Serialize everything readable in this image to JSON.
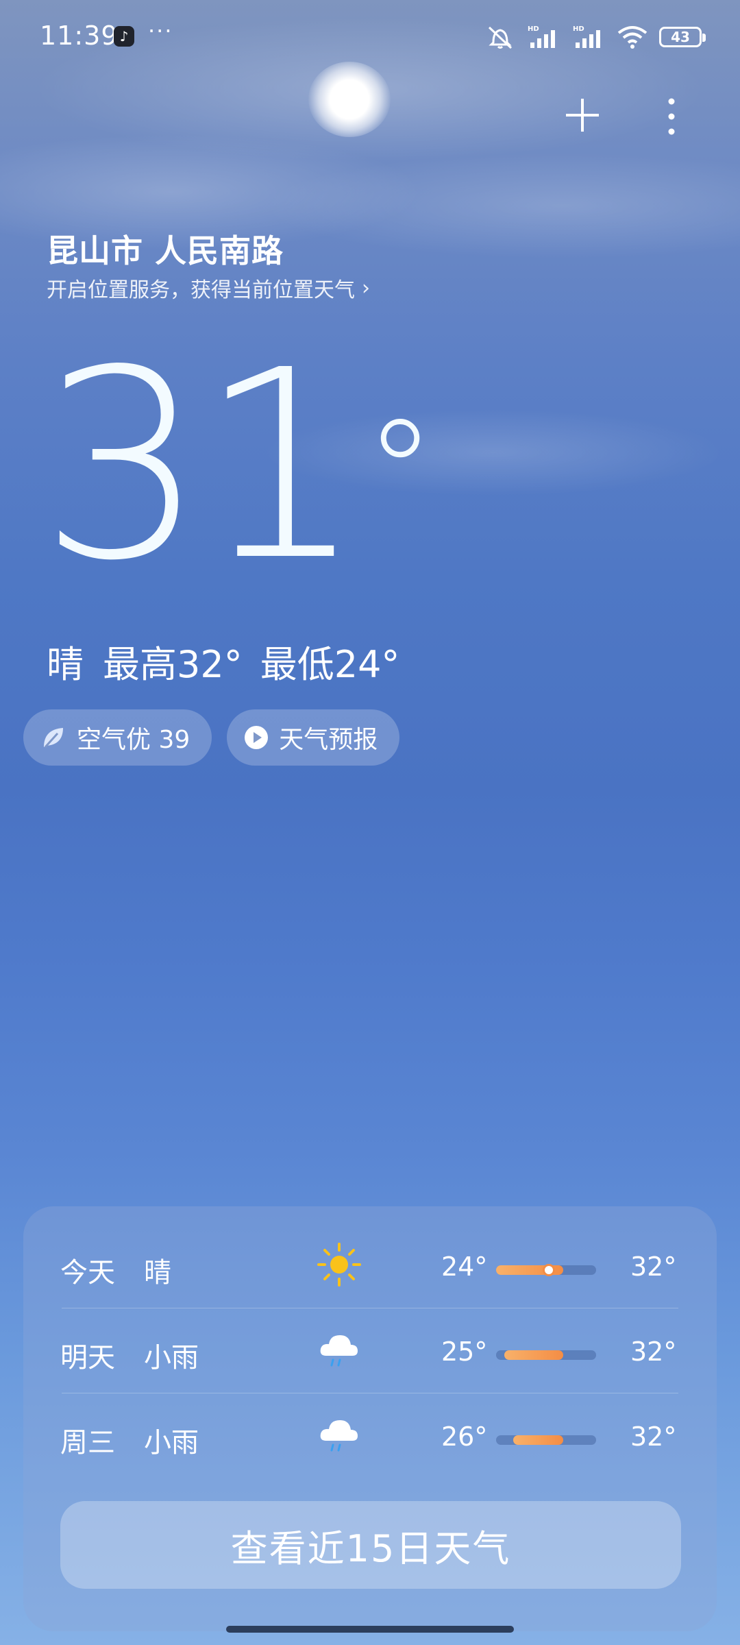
{
  "status_bar": {
    "time": "11:39",
    "app_icon": "tiktok-icon",
    "more": "···",
    "battery": "43",
    "icons": [
      "mute-icon",
      "hd-signal-icon",
      "hd-signal-icon",
      "wifi-icon",
      "battery-icon"
    ]
  },
  "header": {
    "add_icon": "plus-icon",
    "menu_icon": "vertical-dots-icon"
  },
  "location": {
    "title": "昆山市 人民南路",
    "hint": "开启位置服务，获得当前位置天气",
    "hint_arrow": "›"
  },
  "current": {
    "temp": "31",
    "deg": "°",
    "condition": "晴",
    "high": "最高32°",
    "low": "最低24°"
  },
  "chips": {
    "air_label": "空气优 39",
    "forecast_label": "天气预报"
  },
  "forecast": {
    "rows": [
      {
        "day": "今天",
        "condition": "晴",
        "icon": "sun-icon",
        "low": "24°",
        "high": "32°",
        "range_start": 0.0,
        "range_end": 0.67,
        "current_pos": 0.53
      },
      {
        "day": "明天",
        "condition": "小雨",
        "icon": "rain-cloud-icon",
        "low": "25°",
        "high": "32°",
        "range_start": 0.08,
        "range_end": 0.67
      },
      {
        "day": "周三",
        "condition": "小雨",
        "icon": "rain-cloud-icon",
        "low": "26°",
        "high": "32°",
        "range_start": 0.17,
        "range_end": 0.67
      }
    ],
    "more_button": "查看近15日天气"
  },
  "colors": {
    "bar_fill": "#f48d45",
    "sun": "#f9c21a"
  }
}
